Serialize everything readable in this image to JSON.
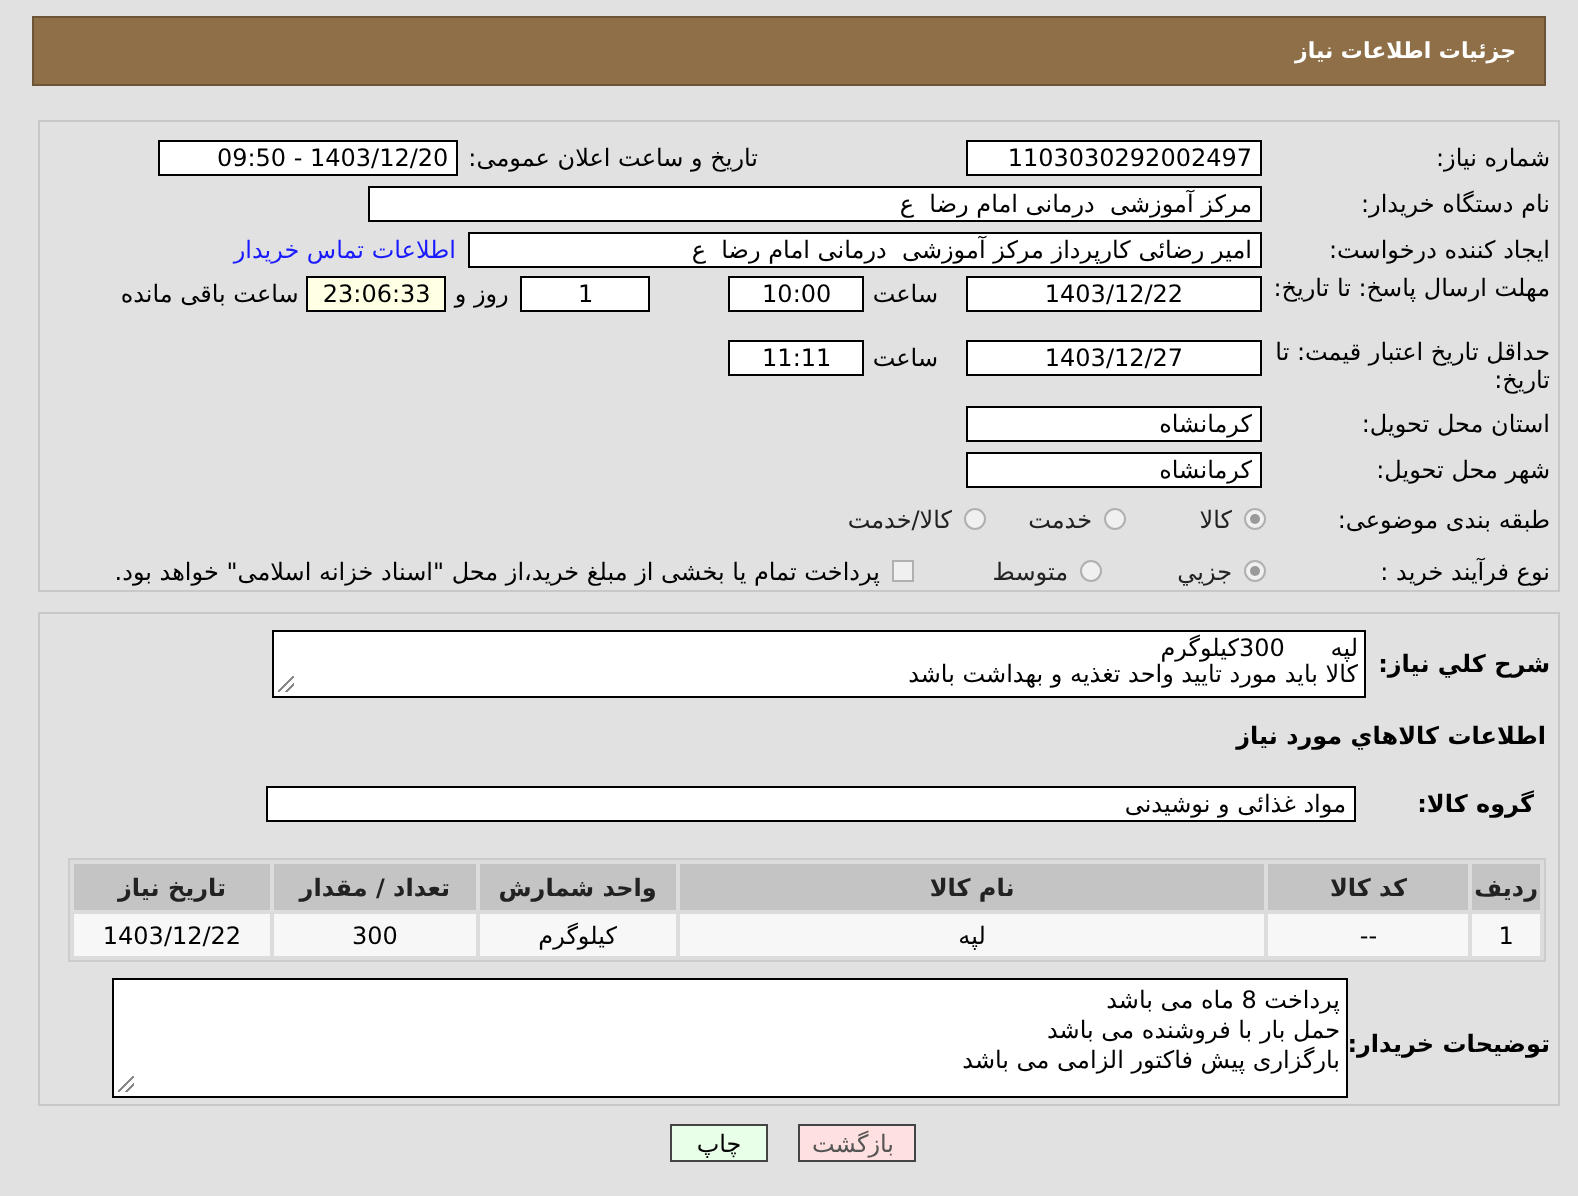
{
  "header": {
    "title": "جزئیات اطلاعات نیاز"
  },
  "need_number": {
    "label": "شماره نیاز:",
    "value": "1103030292002497"
  },
  "announce": {
    "label": "تاریخ و ساعت اعلان عمومی:",
    "value": "1403/12/20 - 09:50"
  },
  "buyer_org": {
    "label": "نام دستگاه خریدار:",
    "value": "مرکز آموزشی  درمانی امام رضا  ع"
  },
  "requester": {
    "label": "ایجاد کننده درخواست:",
    "value": "امیر رضائی کارپرداز مرکز آموزشی  درمانی امام رضا  ع",
    "contact_link": "اطلاعات تماس خریدار"
  },
  "response_deadline": {
    "label": "مهلت ارسال پاسخ: تا تاریخ:",
    "date": "1403/12/22",
    "time_label": "ساعت",
    "time": "10:00",
    "days": "1",
    "days_label": "روز و",
    "remaining": "23:06:33",
    "remaining_label": "ساعت باقی مانده"
  },
  "price_validity": {
    "label": "حداقل تاریخ اعتبار قیمت: تا تاریخ:",
    "date": "1403/12/27",
    "time_label": "ساعت",
    "time": "11:11"
  },
  "province": {
    "label": "استان محل تحویل:",
    "value": "کرمانشاه"
  },
  "city": {
    "label": "شهر محل تحویل:",
    "value": "کرمانشاه"
  },
  "category": {
    "label": "طبقه بندی موضوعی:",
    "options": [
      {
        "label": "کالا",
        "selected": true
      },
      {
        "label": "خدمت",
        "selected": false
      },
      {
        "label": "کالا/خدمت",
        "selected": false
      }
    ]
  },
  "process": {
    "label": "نوع فرآیند خرید :",
    "options": [
      {
        "label": "جزیي",
        "selected": true
      },
      {
        "label": "متوسط",
        "selected": false
      }
    ],
    "payment": {
      "checked": false,
      "text": "پرداخت تمام یا بخشی از مبلغ خرید،از محل \"اسناد خزانه اسلامی\" خواهد بود."
    }
  },
  "description": {
    "label": "شرح کلي نیاز:",
    "lines": [
      "لپه      300کیلوگرم",
      "کالا باید مورد تایید واحد تغذیه و بهداشت باشد"
    ]
  },
  "goods_heading": "اطلاعات کالاهاي مورد نیاز",
  "goods_group": {
    "label": "گروه کالا:",
    "value": "مواد غذائی و نوشیدنی"
  },
  "table": {
    "columns": [
      "ردیف",
      "کد کالا",
      "نام کالا",
      "واحد شمارش",
      "تعداد / مقدار",
      "تاریخ نیاز"
    ],
    "rows": [
      [
        "1",
        "--",
        "لپه",
        "کیلوگرم",
        "300",
        "1403/12/22"
      ]
    ]
  },
  "buyer_notes": {
    "label": "توضیحات خریدار:",
    "lines": [
      "پرداخت 8 ماه می باشد",
      "حمل بار با فروشنده می باشد",
      "بارگزاری پیش فاکتور الزامی می باشد"
    ]
  },
  "buttons": [
    {
      "label": "بازگشت",
      "kind": "back"
    },
    {
      "label": "چاپ",
      "kind": "print"
    }
  ]
}
